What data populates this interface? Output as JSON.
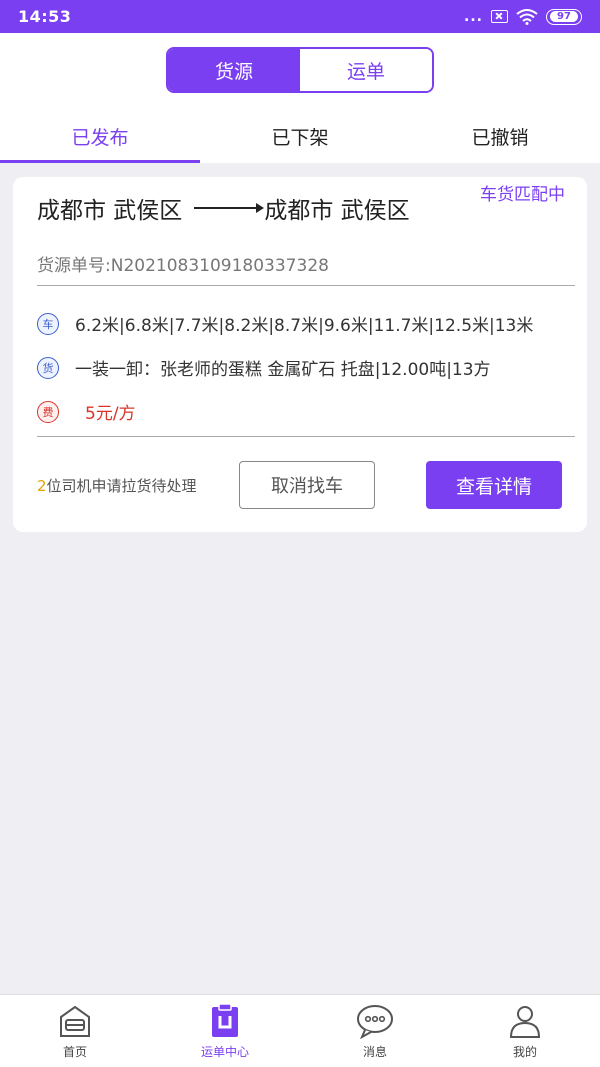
{
  "status_bar": {
    "time": "14:53",
    "dots": "...",
    "battery": "97",
    "icons": [
      "sim-blocked-icon",
      "wifi-icon",
      "battery-icon"
    ]
  },
  "segmented": {
    "options": [
      {
        "label": "货源",
        "active": true
      },
      {
        "label": "运单",
        "active": false
      }
    ]
  },
  "tabs": [
    {
      "label": "已发布",
      "active": true
    },
    {
      "label": "已下架",
      "active": false
    },
    {
      "label": "已撤销",
      "active": false
    }
  ],
  "card": {
    "origin": "成都市 武侯区",
    "destination": "成都市 武侯区",
    "match_status": "车货匹配中",
    "order_number": "货源单号:N2021083109180337328",
    "car_badge": "车",
    "car_info": "6.2米|6.8米|7.7米|8.2米|8.7米|9.6米|11.7米|12.5米|13米",
    "goods_badge": "货",
    "goods_info": "一装一卸：张老师的蛋糕 金属矿石 托盘|12.00吨|13方",
    "fee_badge": "费",
    "fee_info": "5元/方",
    "driver_count": "2",
    "driver_note": "位司机申请拉货待处理",
    "cancel_label": "取消找车",
    "detail_label": "查看详情"
  },
  "bottom_nav": [
    {
      "label": "首页",
      "icon": "home-icon",
      "active": false
    },
    {
      "label": "运单中心",
      "icon": "waybill-icon",
      "active": true
    },
    {
      "label": "消息",
      "icon": "message-icon",
      "active": false
    },
    {
      "label": "我的",
      "icon": "profile-icon",
      "active": false
    }
  ],
  "colors": {
    "accent": "#7b3ff2",
    "fee_red": "#d9342b",
    "badge_blue": "#3a5fcf",
    "count_yellow": "#e0a300",
    "background": "#efeff3"
  }
}
